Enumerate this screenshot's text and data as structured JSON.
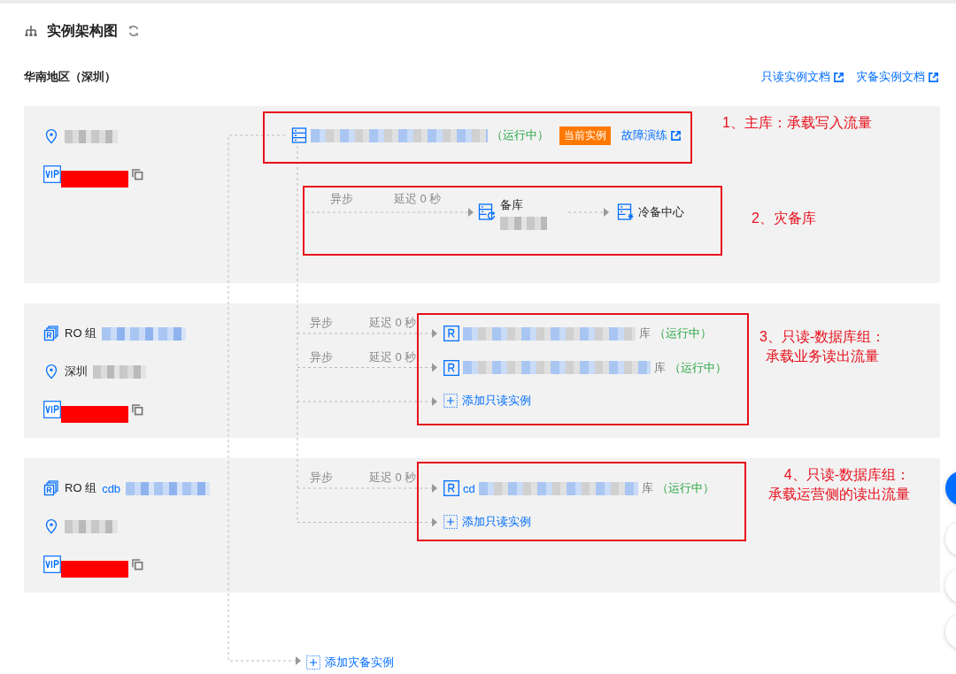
{
  "title": "实例架构图",
  "region": "华南地区（深圳）",
  "doc_links": [
    "只读实例文档",
    "灾备实例文档"
  ],
  "groups": [
    {
      "kind": "master",
      "location": {
        "blurred": true
      },
      "vip_redacted": true,
      "instance": {
        "blurred": true,
        "status": "（运行中）",
        "badge": "当前实例",
        "link": "故障演练"
      },
      "replica": {
        "mode": "异步",
        "delay": "延迟 0 秒",
        "label": "备库",
        "blurred": true
      },
      "cold_backup": "冷备中心"
    },
    {
      "kind": "ro",
      "label": "RO 组",
      "name_blurred": true,
      "location": {
        "text": "深圳",
        "blurred": true
      },
      "vip_redacted": true,
      "instances": [
        {
          "mode": "异步",
          "delay": "延迟 0 秒",
          "blurred": true,
          "suffix": "库",
          "status": "（运行中）"
        },
        {
          "mode": "异步",
          "delay": "延迟 0 秒",
          "blurred": true,
          "suffix": "库",
          "status": "（运行中）"
        }
      ],
      "add": "添加只读实例"
    },
    {
      "kind": "ro",
      "label": "RO 组",
      "name": "cdb",
      "name_blurred": true,
      "location": {
        "blurred": true
      },
      "vip_redacted": true,
      "instances": [
        {
          "mode": "异步",
          "delay": "延迟 0 秒",
          "prefix": "cd",
          "blurred": true,
          "suffix": "库",
          "status": "（运行中）"
        }
      ],
      "add": "添加只读实例"
    }
  ],
  "add_dr": "添加灾备实例",
  "annotations": [
    {
      "lines": [
        "1、主库：承载写入流量"
      ]
    },
    {
      "lines": [
        "2、灾备库"
      ]
    },
    {
      "lines": [
        "3、只读-数据库组：",
        "承载业务读出流量"
      ]
    },
    {
      "lines": [
        "4、只读-数据库组：",
        "承载运营侧的读出流量"
      ]
    }
  ]
}
